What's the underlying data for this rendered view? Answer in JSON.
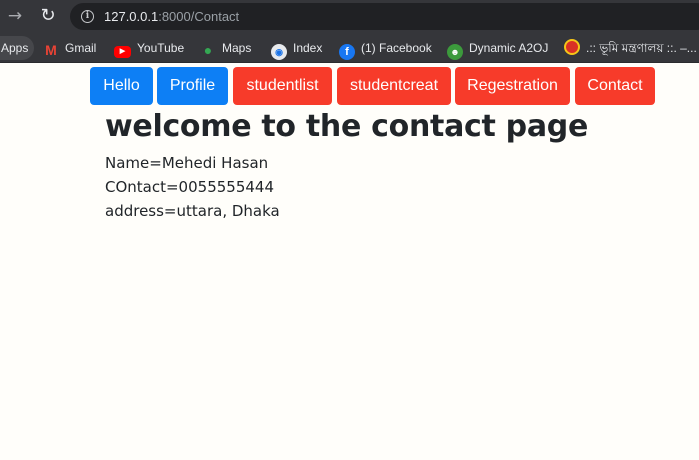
{
  "browser": {
    "url_host": "127.0.0.1",
    "url_rest": ":8000/Contact",
    "bookmarks": [
      {
        "label": "Apps",
        "icon": "apps-icon"
      },
      {
        "label": "Gmail",
        "icon": "gmail-icon"
      },
      {
        "label": "YouTube",
        "icon": "youtube-icon"
      },
      {
        "label": "Maps",
        "icon": "maps-icon"
      },
      {
        "label": "Index",
        "icon": "index-icon"
      },
      {
        "label": "(1) Facebook",
        "icon": "facebook-icon"
      },
      {
        "label": "Dynamic A2OJ",
        "icon": "a2oj-icon"
      },
      {
        "label": ".:: ভূমি মন্ত্রণালয় ::. –...",
        "icon": "bhumi-icon"
      }
    ]
  },
  "nav": {
    "buttons": [
      {
        "label": "Hello",
        "color": "#0d7ff5"
      },
      {
        "label": "Profile",
        "color": "#0d7ff5"
      },
      {
        "label": "studentlist",
        "color": "#f73b2a"
      },
      {
        "label": "studentcreat",
        "color": "#f73b2a"
      },
      {
        "label": "Regestration",
        "color": "#f73b2a"
      },
      {
        "label": "Contact",
        "color": "#f73b2a"
      }
    ]
  },
  "main": {
    "title": "welcome to the contact page",
    "name_line": "Name=Mehedi Hasan",
    "contact_line": "COntact=0055555444",
    "address_line": "address=uttara, Dhaka"
  }
}
